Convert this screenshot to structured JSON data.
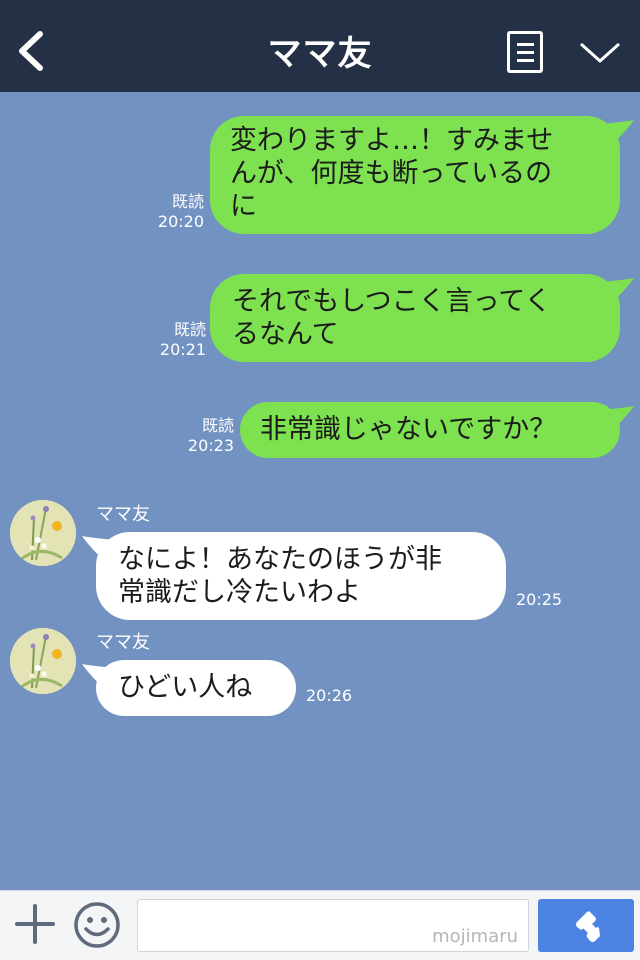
{
  "header": {
    "title": "ママ友",
    "back_icon": "chevron-left-icon",
    "menu_icon": "list-icon",
    "more_icon": "chevron-down-icon"
  },
  "messages": [
    {
      "side": "sent",
      "lines": [
        "変わりますよ…！すみませ",
        "んが、何度も断っているの",
        "に"
      ],
      "read": "既読",
      "time": "20:20"
    },
    {
      "side": "sent",
      "lines": [
        "それでもしつこく言ってく",
        "るなんて"
      ],
      "read": "既読",
      "time": "20:21"
    },
    {
      "side": "sent",
      "lines": [
        "非常識じゃないですか？"
      ],
      "read": "既読",
      "time": "20:23"
    },
    {
      "side": "recv",
      "sender": "ママ友",
      "lines": [
        "なによ！あなたのほうが非",
        "常識だし冷たいわよ"
      ],
      "time": "20:25"
    },
    {
      "side": "recv",
      "sender": "ママ友",
      "lines": [
        "ひどい人ね"
      ],
      "time": "20:26"
    }
  ],
  "footer": {
    "plus_icon": "plus-icon",
    "emoji_icon": "smiley-icon",
    "input_value": "",
    "watermark": "mojimaru",
    "call_icon": "phone-icon"
  },
  "colors": {
    "header_bg": "#243046",
    "chat_bg": "#7293c1",
    "sent_bubble": "#7ee150",
    "recv_bubble": "#ffffff",
    "call_button": "#4d84e3"
  }
}
